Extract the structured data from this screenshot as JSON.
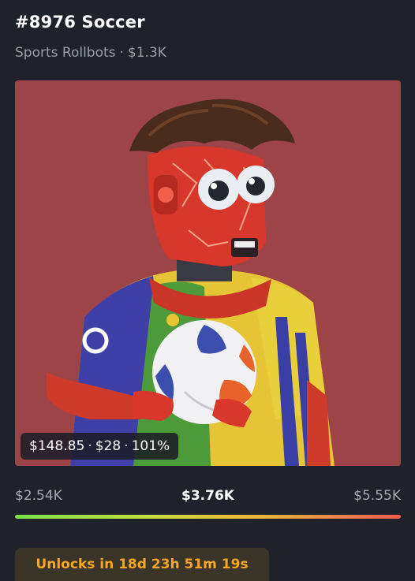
{
  "header": {
    "title": "#8976 Soccer",
    "collection": "Sports Rollbots",
    "separator": "·",
    "floor_price": "$1.3K"
  },
  "artwork": {
    "background_color": "#9c4447",
    "subject": "robot-soccer-player-image"
  },
  "price_badge": {
    "price": "$148.85",
    "change": "$28",
    "percent": "101%",
    "separator": "·"
  },
  "range": {
    "low": "$2.54K",
    "mid": "$3.76K",
    "high": "$5.55K",
    "fill_fraction": 1.0
  },
  "unlock": {
    "label": "Unlocks in 18d 23h 51m 19s"
  },
  "colors": {
    "page_bg": "#1f212b",
    "accent_orange": "#f5a623",
    "bar_start": "#7be04a",
    "bar_end": "#ef5b4f"
  }
}
